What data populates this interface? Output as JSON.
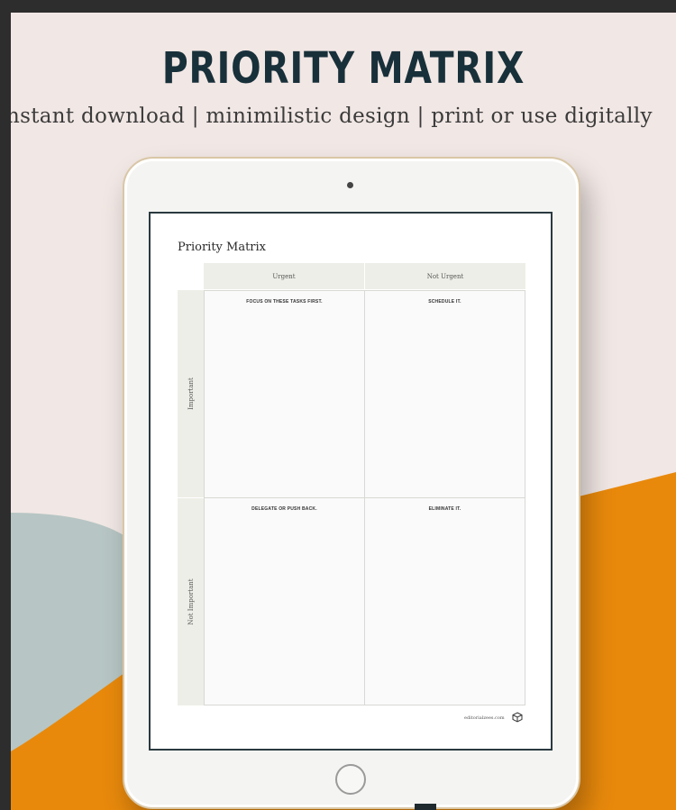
{
  "banner": {
    "title": "PRIORITY MATRIX",
    "subtitle": "nstant download | minimilistic design | print or use digitally"
  },
  "document": {
    "title": "Priority Matrix",
    "columns": [
      "Urgent",
      "Not Urgent"
    ],
    "rows": [
      "Important",
      "Not Important"
    ],
    "cells": [
      [
        "FOCUS ON THESE TASKS FIRST.",
        "SCHEDULE IT."
      ],
      [
        "DELEGATE OR PUSH BACK.",
        "ELIMINATE IT."
      ]
    ],
    "footer_site": "editorialzees.com"
  },
  "colors": {
    "background": "#f1e7e4",
    "title": "#18303a",
    "orange": "#e8890c",
    "sage": "#b7c6c4"
  },
  "icons": [
    "camera-icon",
    "home-button-icon",
    "brand-logo-icon"
  ]
}
